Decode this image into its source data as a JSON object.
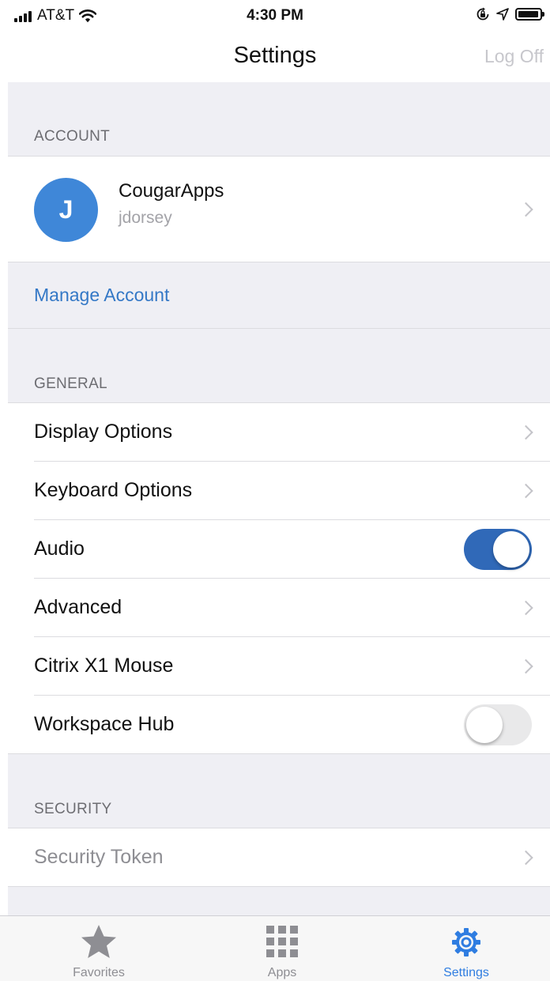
{
  "status_bar": {
    "carrier": "AT&T",
    "time": "4:30 PM",
    "battery_level": 0.95
  },
  "nav": {
    "title": "Settings",
    "action": "Log Off"
  },
  "account": {
    "header": "ACCOUNT",
    "avatar_initial": "J",
    "name": "CougarApps",
    "username": "jdorsey",
    "manage_label": "Manage Account"
  },
  "general": {
    "header": "GENERAL",
    "items": [
      {
        "label": "Display Options",
        "control": "chevron"
      },
      {
        "label": "Keyboard Options",
        "control": "chevron"
      },
      {
        "label": "Audio",
        "control": "toggle",
        "on": true
      },
      {
        "label": "Advanced",
        "control": "chevron"
      },
      {
        "label": "Citrix X1 Mouse",
        "control": "chevron"
      },
      {
        "label": "Workspace Hub",
        "control": "toggle",
        "on": false
      }
    ]
  },
  "security": {
    "header": "SECURITY",
    "items": [
      {
        "label": "Security Token",
        "control": "chevron",
        "disabled": true
      }
    ]
  },
  "tab_bar": {
    "tabs": [
      {
        "label": "Favorites",
        "icon": "star-icon",
        "active": false
      },
      {
        "label": "Apps",
        "icon": "grid-icon",
        "active": false
      },
      {
        "label": "Settings",
        "icon": "gear-icon",
        "active": true
      }
    ]
  },
  "colors": {
    "accent": "#2f7de1",
    "link": "#3478c6",
    "toggle_on": "#3069b8",
    "avatar": "#3f87d8",
    "group_background": "#efeff4"
  }
}
